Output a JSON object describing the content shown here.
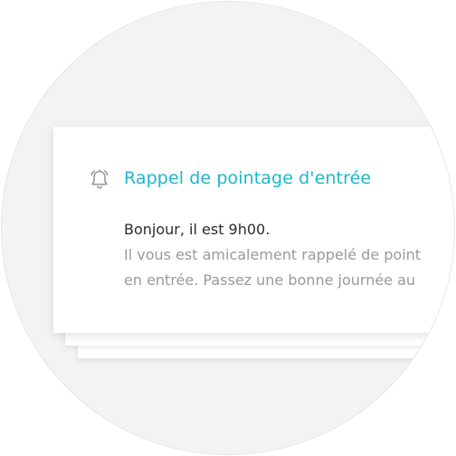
{
  "notification": {
    "icon": "bell-icon",
    "title": "Rappel de pointage d'entrée",
    "greeting": "Bonjour, il est 9h00.",
    "body_line1": "Il vous est amicalement rappelé de point",
    "body_line2": "en entrée. Passez une bonne journée au",
    "accent_color": "#1cb6cc"
  }
}
